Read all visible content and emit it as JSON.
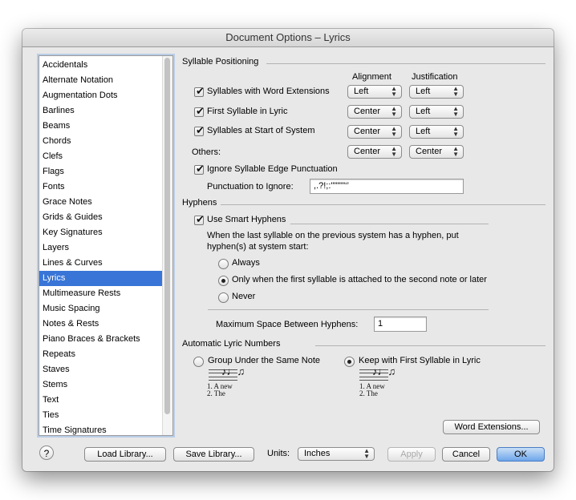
{
  "window": {
    "title": "Document Options – Lyrics"
  },
  "sidebar": {
    "items": [
      "Accidentals",
      "Alternate Notation",
      "Augmentation Dots",
      "Barlines",
      "Beams",
      "Chords",
      "Clefs",
      "Flags",
      "Fonts",
      "Grace Notes",
      "Grids & Guides",
      "Key Signatures",
      "Layers",
      "Lines & Curves",
      "Lyrics",
      "Multimeasure Rests",
      "Music Spacing",
      "Notes & Rests",
      "Piano Braces & Brackets",
      "Repeats",
      "Staves",
      "Stems",
      "Text",
      "Ties",
      "Time Signatures"
    ],
    "selected": "Lyrics"
  },
  "syllable_positioning": {
    "title": "Syllable Positioning",
    "col_alignment": "Alignment",
    "col_justification": "Justification",
    "rows": [
      {
        "label": "Syllables with Word Extensions",
        "checked": true,
        "alignment": "Left",
        "justification": "Left"
      },
      {
        "label": "First Syllable in Lyric",
        "checked": true,
        "alignment": "Center",
        "justification": "Left"
      },
      {
        "label": "Syllables at Start of System",
        "checked": true,
        "alignment": "Center",
        "justification": "Left"
      }
    ],
    "others_label": "Others:",
    "others_alignment": "Center",
    "others_justification": "Center",
    "ignore_edge_label": "Ignore Syllable Edge Punctuation",
    "ignore_edge_checked": true,
    "punct_label": "Punctuation to Ignore:",
    "punct_value": ",.?!;:'\"\"\"\"‘’"
  },
  "hyphens": {
    "title": "Hyphens",
    "smart_label": "Use Smart Hyphens",
    "smart_checked": true,
    "description_line1": "When the last syllable on the previous system has a hyphen, put",
    "description_line2": "hyphen(s) at system start:",
    "options": [
      "Always",
      "Only when the first syllable is attached to the second note or later",
      "Never"
    ],
    "selected_option": "Only when the first syllable is attached to the second note or later",
    "max_space_label": "Maximum Space Between Hyphens:",
    "max_space_value": "1"
  },
  "auto_lyric_numbers": {
    "title": "Automatic Lyric Numbers",
    "option_group": "Group Under the Same Note",
    "option_keep": "Keep with First Syllable in Lyric",
    "selected": "Keep with First Syllable in Lyric",
    "example_group": {
      "line1": "1. A   new",
      "line2": "2.       The"
    },
    "example_keep": {
      "line1": "1. A   new",
      "line2": "2.  The"
    }
  },
  "buttons": {
    "word_extensions": "Word Extensions...",
    "help": "?",
    "load_library": "Load Library...",
    "save_library": "Save Library...",
    "units_label": "Units:",
    "units_value": "Inches",
    "apply": "Apply",
    "cancel": "Cancel",
    "ok": "OK"
  }
}
